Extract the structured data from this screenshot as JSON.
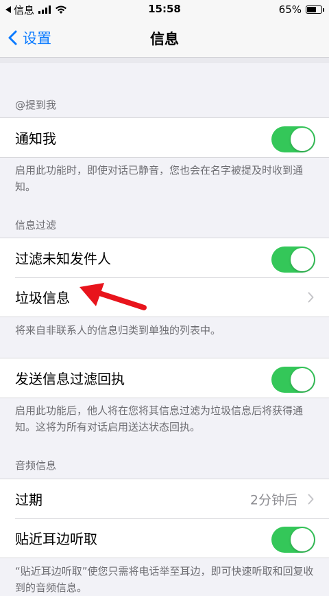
{
  "status_bar": {
    "carrier": "信息",
    "time": "15:58",
    "battery": "65%",
    "battery_level": 0.65
  },
  "nav": {
    "back_label": "设置",
    "title": "信息"
  },
  "sections": {
    "mention": {
      "header": "@提到我",
      "row_label": "通知我",
      "toggle_on": true,
      "footer": "启用此功能时，即使对话已静音，您也会在名字被提及时收到通知。"
    },
    "filter": {
      "header": "信息过滤",
      "unknown_senders_label": "过滤未知发件人",
      "unknown_senders_on": true,
      "junk_label": "垃圾信息",
      "footer": "将来自非联系人的信息归类到单独的列表中。"
    },
    "receipt": {
      "row_label": "发送信息过滤回执",
      "toggle_on": true,
      "footer": "启用此功能后，他人将在您将其信息过滤为垃圾信息后将获得通知。这将为所有对话启用送达状态回执。"
    },
    "audio": {
      "header": "音频信息",
      "expire_label": "过期",
      "expire_value": "2分钟后",
      "raise_label": "贴近耳边听取",
      "raise_on": true,
      "footer": "“贴近耳边听取”使您只需将电话举至耳边，即可快速听取和回复收到的音频信息。"
    }
  },
  "colors": {
    "accent": "#0a7aff",
    "toggle_on": "#34c759",
    "annotation_arrow": "#e8141c"
  }
}
